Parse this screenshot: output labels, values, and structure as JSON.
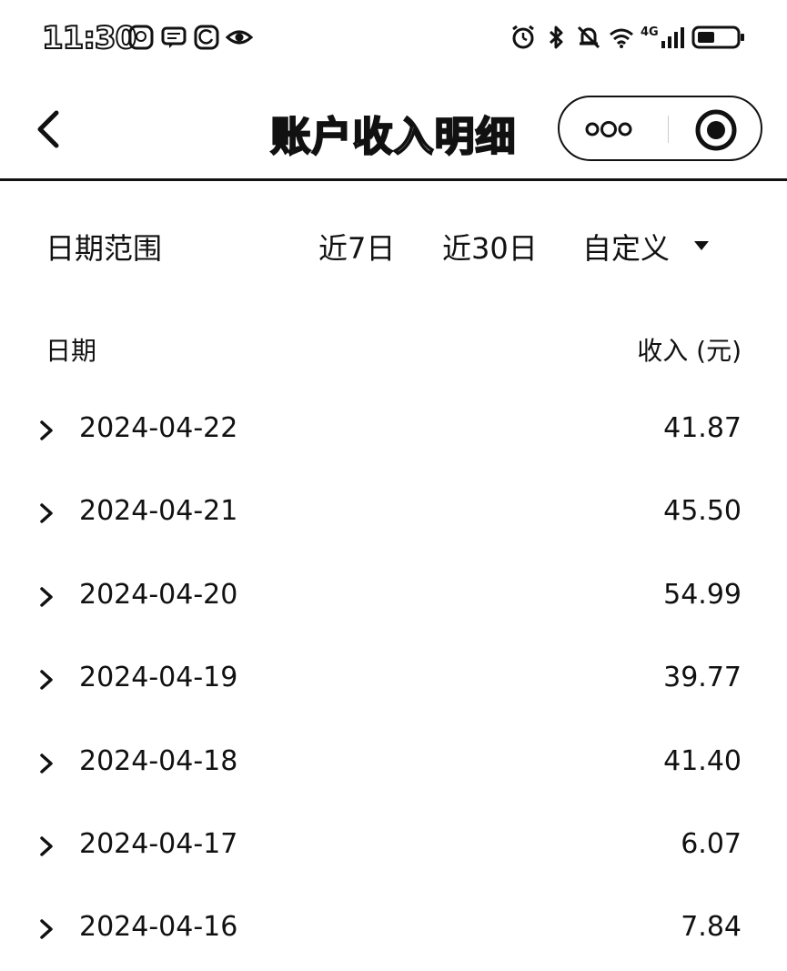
{
  "status_bar": {
    "time": "11:30",
    "left_icons": [
      "qq-icon",
      "message-icon",
      "sync-icon",
      "eye-icon"
    ],
    "right_icons": [
      "alarm-icon",
      "bluetooth-icon",
      "mute-icon",
      "wifi-icon",
      "signal-icon",
      "battery-icon"
    ],
    "network_label": "4G"
  },
  "nav": {
    "title": "账户收入明细",
    "back_icon": "chevron-left-icon",
    "more_icon": "more-dots-icon",
    "close_icon": "target-icon"
  },
  "filter": {
    "label": "日期范围",
    "options": [
      "近7日",
      "近30日",
      "自定义"
    ],
    "dropdown_icon": "caret-down-icon"
  },
  "table": {
    "headers": {
      "date": "日期",
      "income": "收入 (元)"
    },
    "rows": [
      {
        "date": "2024-04-22",
        "amount": "41.87"
      },
      {
        "date": "2024-04-21",
        "amount": "45.50"
      },
      {
        "date": "2024-04-20",
        "amount": "54.99"
      },
      {
        "date": "2024-04-19",
        "amount": "39.77"
      },
      {
        "date": "2024-04-18",
        "amount": "41.40"
      },
      {
        "date": "2024-04-17",
        "amount": "6.07"
      },
      {
        "date": "2024-04-16",
        "amount": "7.84"
      }
    ]
  }
}
